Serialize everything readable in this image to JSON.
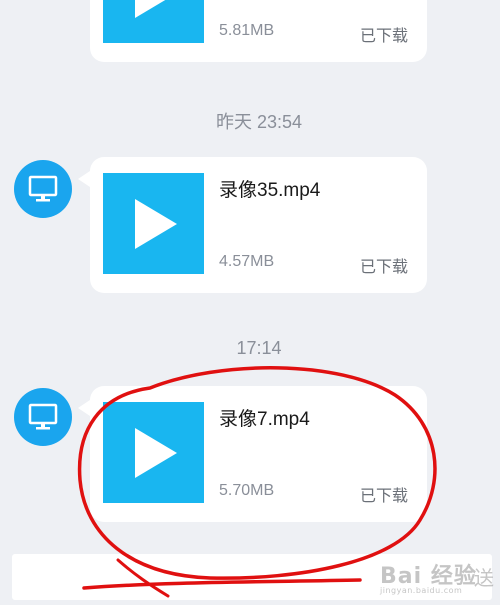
{
  "messages": [
    {
      "filename": "",
      "size": "5.81MB",
      "status": "已下载"
    },
    {
      "timestamp": "昨天 23:54",
      "filename": "录像35.mp4",
      "size": "4.57MB",
      "status": "已下载"
    },
    {
      "timestamp": "17:14",
      "filename": "录像7.mp4",
      "size": "5.70MB",
      "status": "已下载"
    }
  ],
  "watermark": {
    "text": "Bai 经验",
    "sub": "jingyan.baidu.com",
    "extra": "送"
  },
  "colors": {
    "background": "#eef0f4",
    "bubble": "#ffffff",
    "thumbnail": "#19b6f0",
    "avatar": "#1aa5ee",
    "annotation": "#e01010"
  },
  "icons": {
    "avatar": "monitor-icon",
    "thumbnail": "play-icon"
  }
}
